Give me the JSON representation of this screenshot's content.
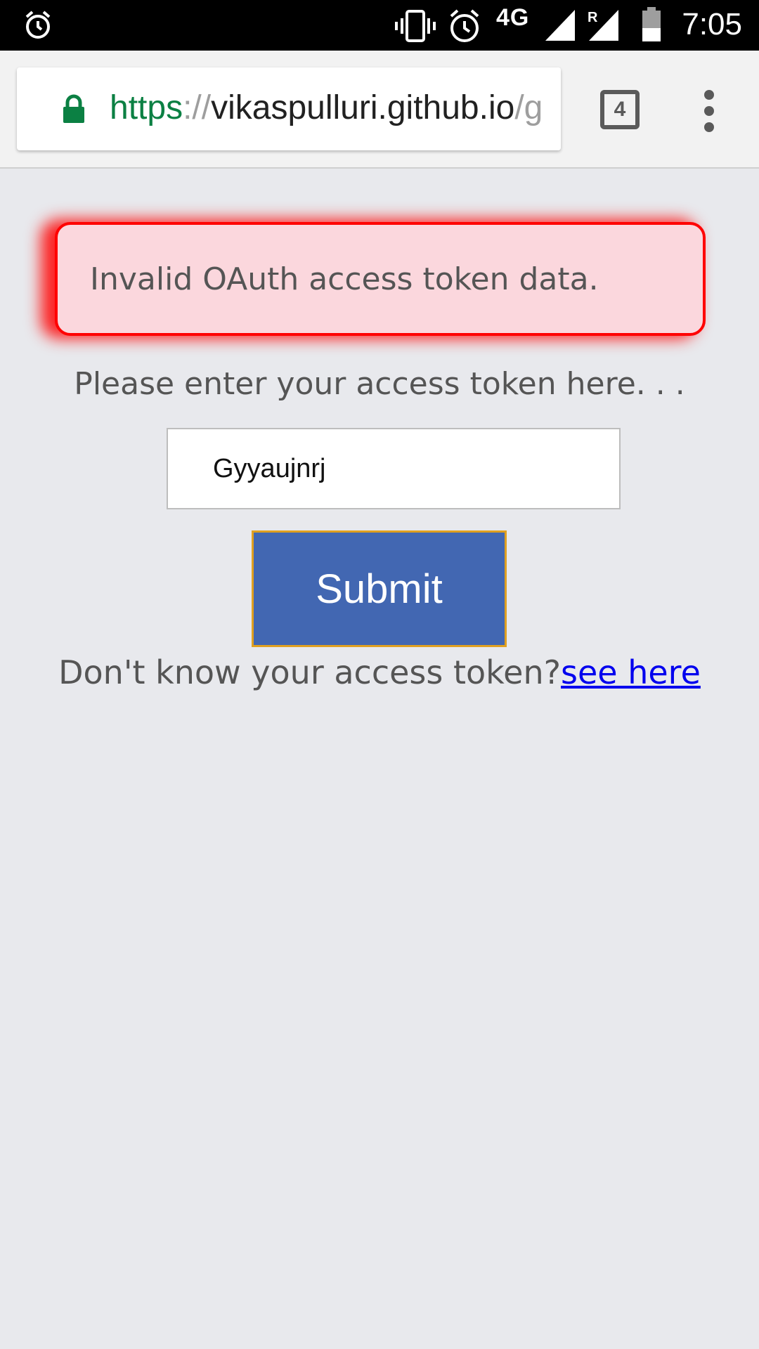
{
  "status_bar": {
    "network": "4G",
    "roaming": "R",
    "time": "7:05",
    "icons": [
      "alarm-icon",
      "vibrate-icon",
      "alarm-icon",
      "signal-icon",
      "roaming-signal-icon",
      "battery-icon"
    ]
  },
  "browser": {
    "url": {
      "scheme": "https",
      "separator": "://",
      "host": "vikaspulluri.github.io",
      "path": "/g"
    },
    "tab_count": "4",
    "colors": {
      "secure_scheme": "#0b8043",
      "toolbar_bg": "#f2f2f2"
    }
  },
  "page": {
    "alert": {
      "message": "Invalid OAuth access token data.",
      "border_color": "#ff0000",
      "bg_color": "#fbd7dd"
    },
    "prompt": "Please enter your access token here. . .",
    "token_input": {
      "value": "Gyyaujnrj"
    },
    "submit_label": "Submit",
    "help": {
      "text": "Don't know your access token?",
      "link_text": "see here"
    },
    "colors": {
      "background": "#e8e9ed",
      "button": "#4267b2",
      "button_border": "#e0a020",
      "link": "#0000ee"
    }
  }
}
